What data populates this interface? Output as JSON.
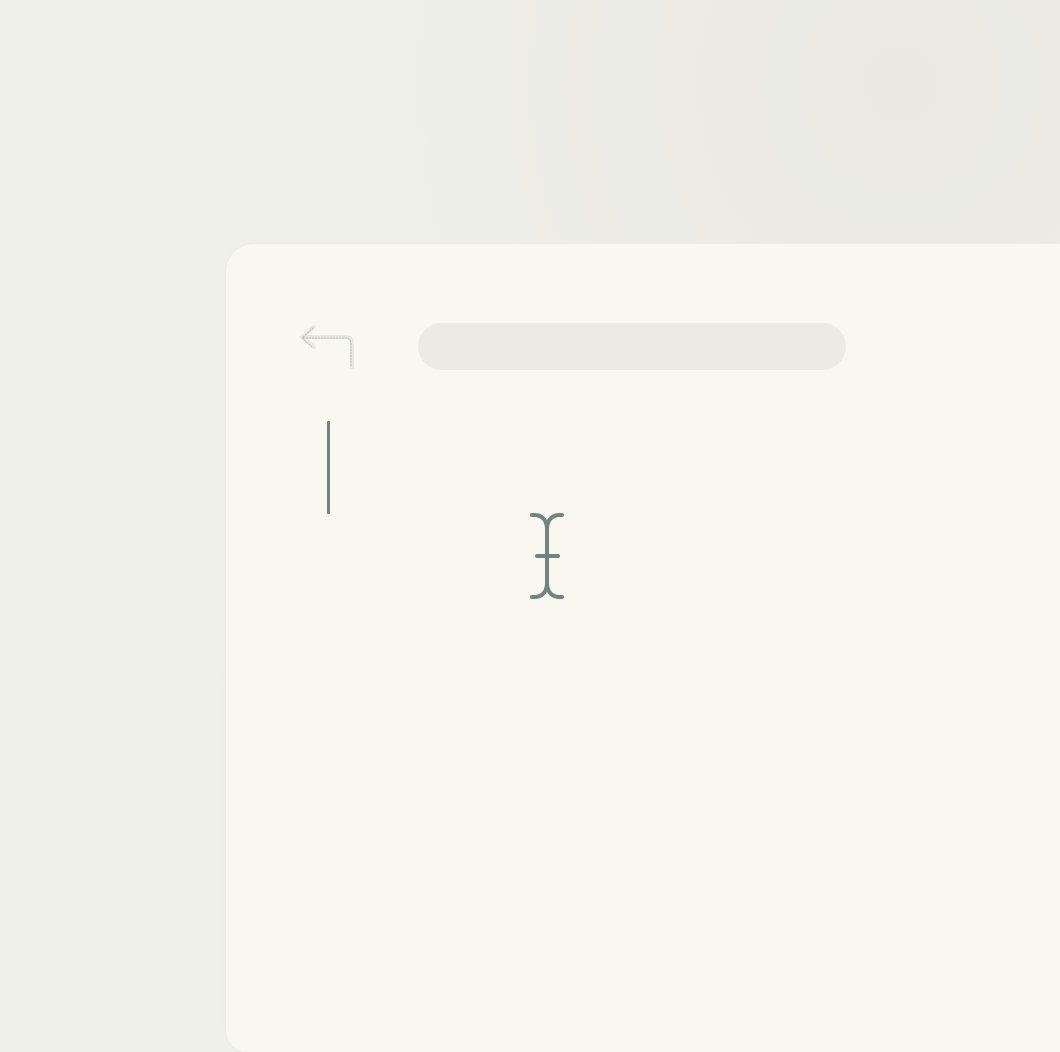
{
  "window": {
    "background_color": "#f0f0ea",
    "panel_color": "#f8f8f1"
  },
  "toolbar": {
    "back_icon": "back-arrow-icon",
    "address_value": "",
    "address_placeholder": ""
  },
  "editor": {
    "caret_color": "#6f8580",
    "cursor_icon": "i-beam-cursor-icon"
  }
}
